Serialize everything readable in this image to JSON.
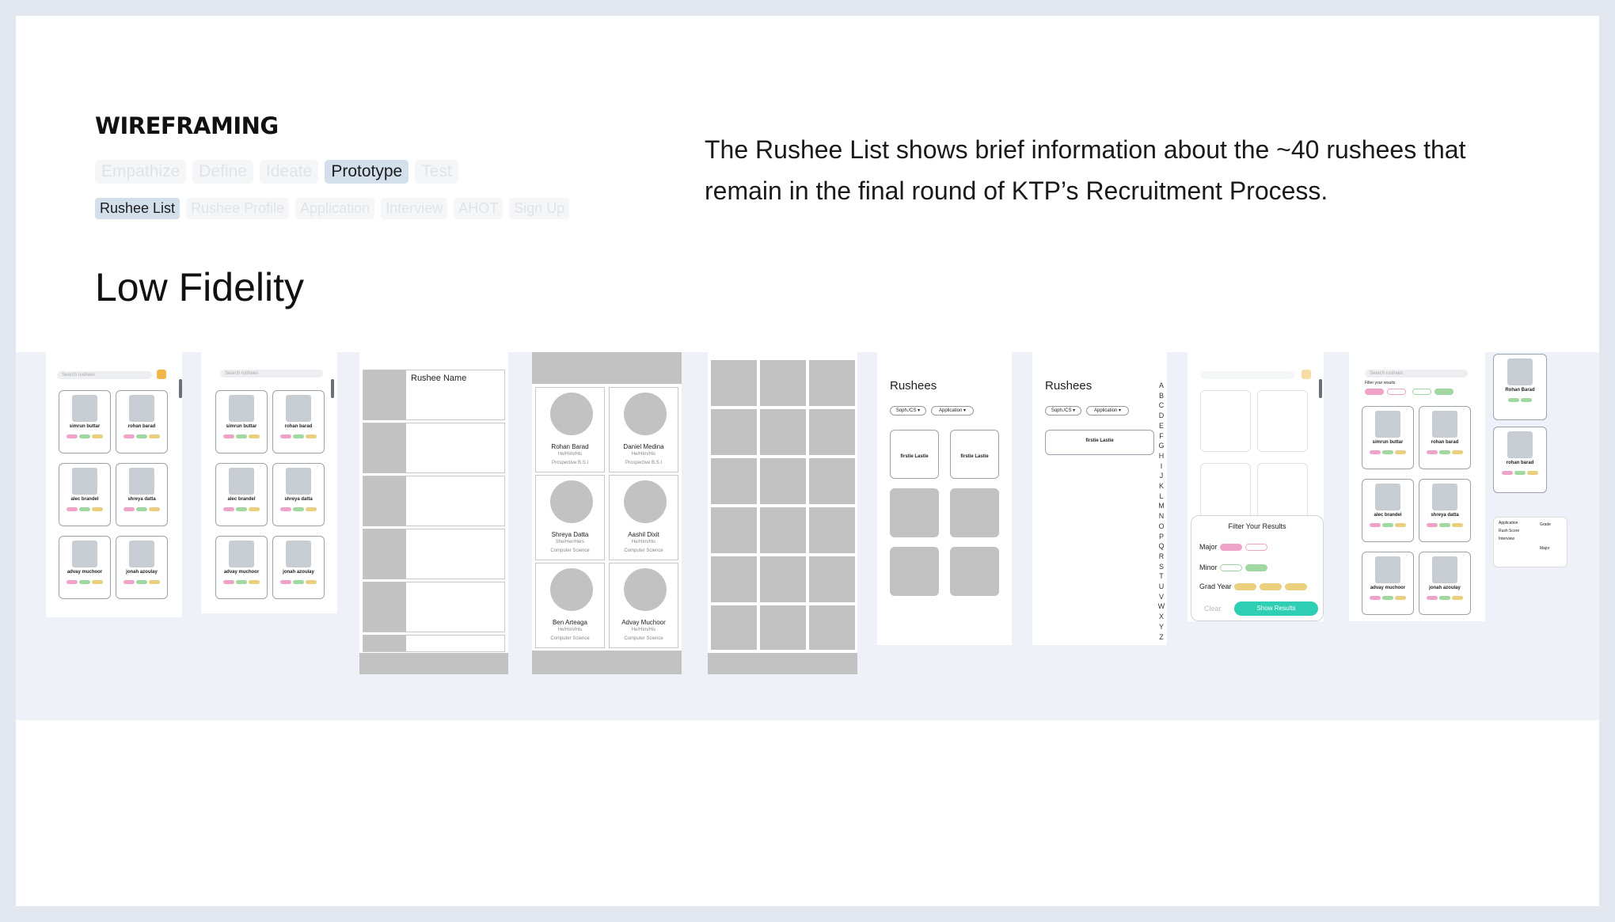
{
  "header": {
    "title": "WIREFRAMING",
    "phases": [
      "Empathize",
      "Define",
      "Ideate",
      "Prototype",
      "Test"
    ],
    "active_phase": "Prototype",
    "screens": [
      "Rushee List",
      "Rushee Profile",
      "Application",
      "Interview",
      "AHOT",
      "Sign Up"
    ],
    "active_screen": "Rushee List"
  },
  "description": "The Rushee List shows brief information about the ~40 rushees that remain in the final round of KTP’s Recruitment Process.",
  "section_title": "Low Fidelity",
  "wireframes": {
    "search_placeholder": "Search rushees",
    "people": [
      "simrun buttar",
      "rohan barad",
      "alec brandel",
      "shreya datta",
      "advay muchoor",
      "jonah azoulay"
    ],
    "rushee_name_label": "Rushee Name",
    "profile_cards": [
      {
        "name": "Rohan Barad",
        "pronouns": "He/Him/His",
        "detail": "Prospective B.S.I"
      },
      {
        "name": "Daniel Medina",
        "pronouns": "He/Him/His",
        "detail": "Prospective B.S.I"
      },
      {
        "name": "Shreya Datta",
        "pronouns": "She/Her/Hers",
        "detail": "Computer Science"
      },
      {
        "name": "Aashil Dixit",
        "pronouns": "He/Him/His",
        "detail": "Computer Science"
      },
      {
        "name": "Ben Arteaga",
        "pronouns": "He/Him/His",
        "detail": "Computer Science"
      },
      {
        "name": "Advay Muchoor",
        "pronouns": "He/Him/His",
        "detail": "Computer Science"
      }
    ],
    "rushees_heading": "Rushees",
    "filter_soph": "Soph./CS ▾",
    "filter_app": "Application ▾",
    "firstie": "firstie Lastie",
    "alphabet": [
      "A",
      "B",
      "C",
      "D",
      "E",
      "F",
      "G",
      "H",
      "I",
      "J",
      "K",
      "L",
      "M",
      "N",
      "O",
      "P",
      "Q",
      "R",
      "S",
      "T",
      "U",
      "V",
      "W",
      "X",
      "Y",
      "Z"
    ],
    "filter_panel": {
      "title": "Filter Your Results",
      "rows": [
        "Major",
        "Minor",
        "Grad Year"
      ],
      "clear": "Clear",
      "show": "Show Results"
    },
    "filter_label": "Filter your results",
    "side_cards": [
      "Rohan Barad",
      "rohan barad"
    ],
    "table_left": [
      "Application",
      "Rush Score",
      "Interview"
    ],
    "table_right": [
      "Grade",
      "Major"
    ]
  },
  "colors": {
    "active_tab": "#d4dfec",
    "teal": "#2fcfb5",
    "pink": "#f0a3c8",
    "green": "#9fd8a0",
    "yellow": "#e9cf7e"
  }
}
